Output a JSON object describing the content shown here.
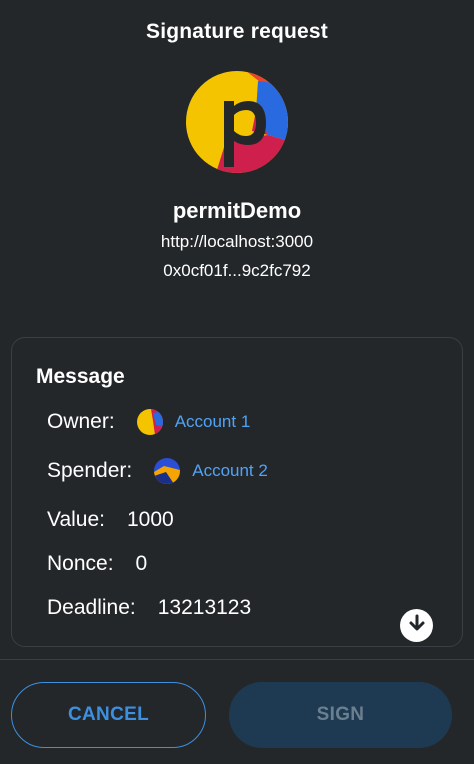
{
  "header": {
    "title": "Signature request"
  },
  "site": {
    "logo_icon": "site-logo-p-icon",
    "name": "permitDemo",
    "origin": "http://localhost:3000",
    "contract": "0x0cf01f...9c2fc792"
  },
  "message": {
    "title": "Message",
    "owner": {
      "label": "Owner:",
      "account": "Account 1",
      "avatar_icon": "account-avatar-icon"
    },
    "spender": {
      "label": "Spender:",
      "account": "Account 2",
      "avatar_icon": "account-avatar-icon"
    },
    "value": {
      "label": "Value:",
      "value": "1000"
    },
    "nonce": {
      "label": "Nonce:",
      "value": "0"
    },
    "deadline": {
      "label": "Deadline:",
      "value": "13213123"
    },
    "scroll_icon": "arrow-down-circle-icon"
  },
  "actions": {
    "cancel_label": "CANCEL",
    "sign_label": "SIGN"
  },
  "colors": {
    "background": "#24272a",
    "accent": "#3d8fe0",
    "link": "#4fa3f7",
    "sign_disabled_bg": "#1e3a52"
  }
}
